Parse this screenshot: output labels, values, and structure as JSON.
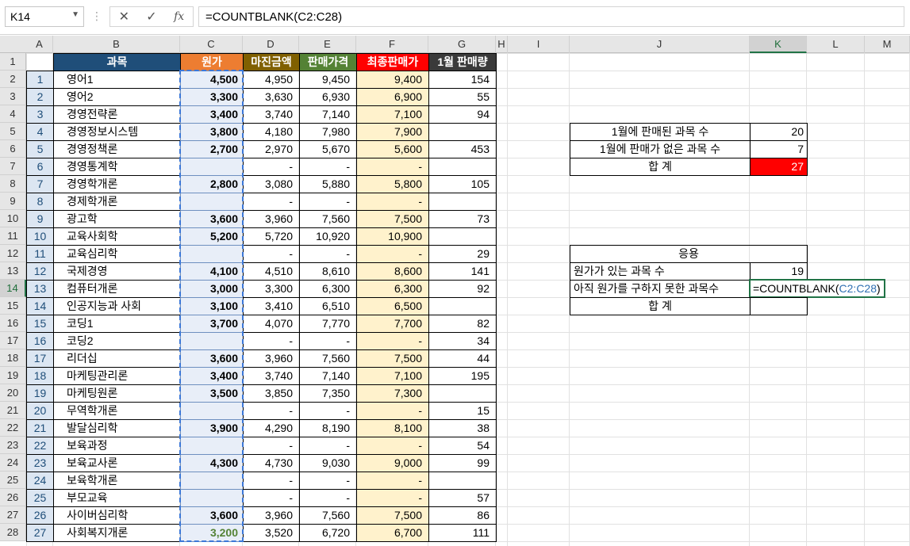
{
  "formula_bar": {
    "name_box": "K14",
    "cancel_icon": "✕",
    "enter_icon": "✓",
    "fx_label": "fx",
    "formula": "=COUNTBLANK(C2:C28)"
  },
  "columns": [
    "A",
    "B",
    "C",
    "D",
    "E",
    "F",
    "G",
    "H",
    "I",
    "J",
    "K",
    "L",
    "M"
  ],
  "rows": [
    "1",
    "2",
    "3",
    "4",
    "5",
    "6",
    "7",
    "8",
    "9",
    "10",
    "11",
    "12",
    "13",
    "14",
    "15",
    "16",
    "17",
    "18",
    "19",
    "20",
    "21",
    "22",
    "23",
    "24",
    "25",
    "26",
    "27",
    "28"
  ],
  "table": {
    "headers": {
      "subject": "과목",
      "cost": "원가",
      "margin": "마진금액",
      "price": "판매가격",
      "final": "최종판매가",
      "jan_sales": "1월 판매량"
    },
    "header_colors": {
      "subject": "#1f4e79",
      "cost": "#ed7d31",
      "margin": "#806000",
      "price": "#548235",
      "final": "#ff0000",
      "jan_sales": "#3a3a3a"
    },
    "rows": [
      {
        "no": "1",
        "subject": "영어1",
        "cost": "4,500",
        "margin": "4,950",
        "price": "9,450",
        "final": "9,400",
        "sales": "154"
      },
      {
        "no": "2",
        "subject": "영어2",
        "cost": "3,300",
        "margin": "3,630",
        "price": "6,930",
        "final": "6,900",
        "sales": "55"
      },
      {
        "no": "3",
        "subject": "경영전략론",
        "cost": "3,400",
        "margin": "3,740",
        "price": "7,140",
        "final": "7,100",
        "sales": "94"
      },
      {
        "no": "4",
        "subject": "경영정보시스템",
        "cost": "3,800",
        "margin": "4,180",
        "price": "7,980",
        "final": "7,900",
        "sales": ""
      },
      {
        "no": "5",
        "subject": "경영정책론",
        "cost": "2,700",
        "margin": "2,970",
        "price": "5,670",
        "final": "5,600",
        "sales": "453"
      },
      {
        "no": "6",
        "subject": "경영통계학",
        "cost": "",
        "margin": "-",
        "price": "-",
        "final": "-",
        "sales": ""
      },
      {
        "no": "7",
        "subject": "경영학개론",
        "cost": "2,800",
        "margin": "3,080",
        "price": "5,880",
        "final": "5,800",
        "sales": "105"
      },
      {
        "no": "8",
        "subject": "경제학개론",
        "cost": "",
        "margin": "-",
        "price": "-",
        "final": "-",
        "sales": ""
      },
      {
        "no": "9",
        "subject": "광고학",
        "cost": "3,600",
        "margin": "3,960",
        "price": "7,560",
        "final": "7,500",
        "sales": "73"
      },
      {
        "no": "10",
        "subject": "교육사회학",
        "cost": "5,200",
        "margin": "5,720",
        "price": "10,920",
        "final": "10,900",
        "sales": ""
      },
      {
        "no": "11",
        "subject": "교육심리학",
        "cost": "",
        "margin": "-",
        "price": "-",
        "final": "-",
        "sales": "29"
      },
      {
        "no": "12",
        "subject": "국제경영",
        "cost": "4,100",
        "margin": "4,510",
        "price": "8,610",
        "final": "8,600",
        "sales": "141"
      },
      {
        "no": "13",
        "subject": "컴퓨터개론",
        "cost": "3,000",
        "margin": "3,300",
        "price": "6,300",
        "final": "6,300",
        "sales": "92"
      },
      {
        "no": "14",
        "subject": "인공지능과 사회",
        "cost": "3,100",
        "margin": "3,410",
        "price": "6,510",
        "final": "6,500",
        "sales": ""
      },
      {
        "no": "15",
        "subject": "코딩1",
        "cost": "3,700",
        "margin": "4,070",
        "price": "7,770",
        "final": "7,700",
        "sales": "82"
      },
      {
        "no": "16",
        "subject": "코딩2",
        "cost": "",
        "margin": "-",
        "price": "-",
        "final": "-",
        "sales": "34"
      },
      {
        "no": "17",
        "subject": "리더십",
        "cost": "3,600",
        "margin": "3,960",
        "price": "7,560",
        "final": "7,500",
        "sales": "44"
      },
      {
        "no": "18",
        "subject": "마케팅관리론",
        "cost": "3,400",
        "margin": "3,740",
        "price": "7,140",
        "final": "7,100",
        "sales": "195"
      },
      {
        "no": "19",
        "subject": "마케팅원론",
        "cost": "3,500",
        "margin": "3,850",
        "price": "7,350",
        "final": "7,300",
        "sales": ""
      },
      {
        "no": "20",
        "subject": "무역학개론",
        "cost": "",
        "margin": "-",
        "price": "-",
        "final": "-",
        "sales": "15"
      },
      {
        "no": "21",
        "subject": "발달심리학",
        "cost": "3,900",
        "margin": "4,290",
        "price": "8,190",
        "final": "8,100",
        "sales": "38"
      },
      {
        "no": "22",
        "subject": "보육과정",
        "cost": "",
        "margin": "-",
        "price": "-",
        "final": "-",
        "sales": "54"
      },
      {
        "no": "23",
        "subject": "보육교사론",
        "cost": "4,300",
        "margin": "4,730",
        "price": "9,030",
        "final": "9,000",
        "sales": "99"
      },
      {
        "no": "24",
        "subject": "보육학개론",
        "cost": "",
        "margin": "-",
        "price": "-",
        "final": "-",
        "sales": ""
      },
      {
        "no": "25",
        "subject": "부모교육",
        "cost": "",
        "margin": "-",
        "price": "-",
        "final": "-",
        "sales": "57"
      },
      {
        "no": "26",
        "subject": "사이버심리학",
        "cost": "3,600",
        "margin": "3,960",
        "price": "7,560",
        "final": "7,500",
        "sales": "86"
      },
      {
        "no": "27",
        "subject": "사회복지개론",
        "cost": "3,200",
        "margin": "3,520",
        "price": "6,720",
        "final": "6,700",
        "sales": "111"
      }
    ]
  },
  "summary1": {
    "sold_label": "1월에 판매된 과목 수",
    "sold_value": "20",
    "unsold_label": "1월에 판매가 없은 과목 수",
    "unsold_value": "7",
    "total_label": "합 계",
    "total_value": "27",
    "total_bg": "#ff0000"
  },
  "summary2": {
    "title": "응용",
    "with_cost_label": "원가가 있는 과목 수",
    "with_cost_value": "19",
    "no_cost_label": "아직 원가를 구하지 못한 과목수",
    "no_cost_formula_prefix": "=COUNTBLANK(",
    "no_cost_formula_ref": "C2:C28",
    "no_cost_formula_suffix": ")",
    "total_label": "합 계",
    "total_value": ""
  }
}
